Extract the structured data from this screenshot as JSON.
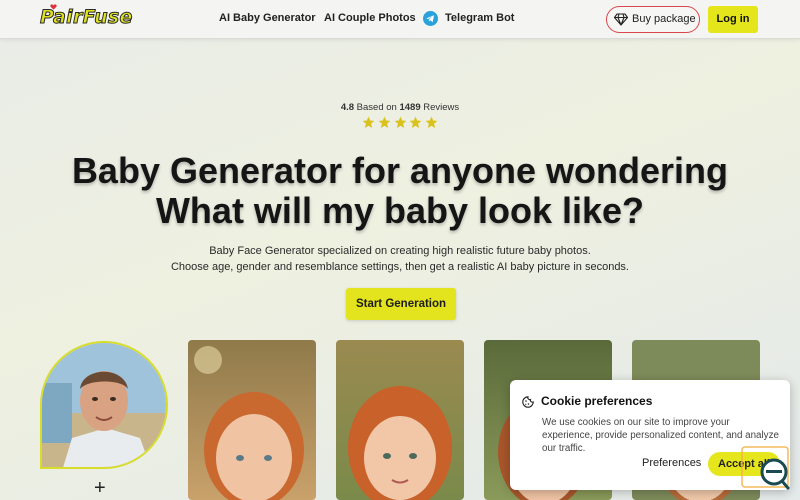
{
  "brand": {
    "name": "PairFuse",
    "accent": "#e3e31e",
    "danger": "#d8474b"
  },
  "nav": {
    "links": [
      {
        "label": "AI Baby Generator"
      },
      {
        "label": "AI Couple Photos"
      },
      {
        "label": "Telegram Bot",
        "icon": "telegram-icon"
      }
    ],
    "buy_label": "Buy package",
    "buy_icon": "diamond-icon",
    "login_label": "Log in"
  },
  "hero": {
    "rating_value": "4.8",
    "rating_mid": " Based on ",
    "rating_count": "1489",
    "rating_suffix": " Reviews",
    "stars": 5,
    "headline_line1": "Baby Generator for anyone wondering",
    "headline_line2": "What will my baby look like?",
    "sub_line1": "Baby Face Generator specialized on creating high realistic future baby photos.",
    "sub_line2": "Choose age, gender and resemblance settings, then get a realistic AI baby picture in seconds.",
    "cta_label": "Start Generation"
  },
  "gallery": {
    "plus_symbol": "+"
  },
  "cookie": {
    "icon": "cookie-icon",
    "title": "Cookie preferences",
    "description": "We use cookies on our site to improve your experience, provide personalized content, and analyze our traffic.",
    "preferences_label": "Preferences",
    "accept_label": "Accept all"
  }
}
